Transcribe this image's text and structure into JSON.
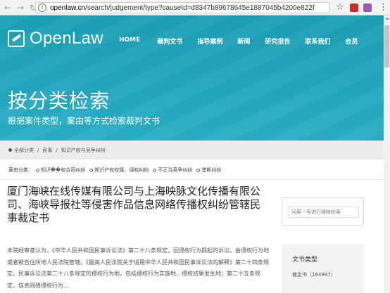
{
  "browser": {
    "url_host": "openlaw.cn",
    "url_path": "/search/judgement/type?causeId=d8347b89678645e1887045b4200e822f"
  },
  "brand": {
    "name": "OpenLaw"
  },
  "topnav": [
    "HOME",
    "裁判文书",
    "指导案例",
    "新闻",
    "研究报告",
    "联系我们",
    "会员"
  ],
  "hero": {
    "title": "按分类检索",
    "subtitle": "根据案件类型，案由等方式检索裁判文书"
  },
  "breadcrumb": {
    "items": [
      "全部分类",
      "/",
      "民事",
      "/",
      "知识产权与竞争纠纷"
    ]
  },
  "filter": {
    "label": "案由分类：",
    "tags": [
      "知识��权合同纠纷",
      "知识产权权属、侵权纠纷",
      "不正当竞争纠纷",
      "垄断纠纷"
    ]
  },
  "article": {
    "title": "厦门海峡在线传媒有限公司与上海映脉文化传播有限公司、海峡导报社等侵害作品信息网络传播权纠纷管辖民事裁定书",
    "excerpt": "本院经审查认为，《中华人民共和国民事诉讼法》第二十八条规定，因侵权行为提起的诉讼，由侵权行为地或者被告住所地人民法院管辖。《最高人民法院关于适用中华人民共和国民事诉讼法的解释》第二十四条规定，民事诉讼法第二十八条规定的侵权行为地，包括侵权行为实施地、侵权结果发生地；第二十五条规定，信息网络侵权行为..."
  },
  "sidebar": {
    "search_placeholder": "问用 - 号进行排除检索",
    "facet_heading": "文书类型",
    "facet_item": "裁定书（164987）"
  },
  "colors": {
    "hero": "#23a8bf"
  }
}
